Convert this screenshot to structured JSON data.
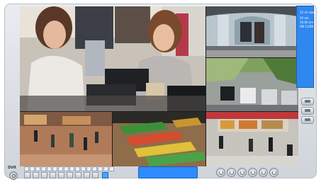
{
  "app": {
    "logo_text": "DVR"
  },
  "sidebar": {
    "info_lines": [
      "12 ch view",
      "20 am",
      "10:00 am",
      "ON 11/08"
    ],
    "buttons": [
      "layout-button-1",
      "layout-button-2",
      "layout-button-3"
    ]
  },
  "cameras": [
    "retail-checkout",
    "revolving-door-entrance",
    "parking-lot",
    "store-floor-left",
    "grocery-aisle",
    "supermarket-entrance"
  ],
  "toolbar": {
    "channel_count": 16,
    "layout_count": 10,
    "display_text": "",
    "controls": [
      "rewind-icon",
      "play-icon",
      "pause-icon",
      "stop-icon",
      "record-icon",
      "forward-icon"
    ]
  },
  "colors": {
    "accent": "#2f88f0",
    "frame": "#cfd4da"
  }
}
